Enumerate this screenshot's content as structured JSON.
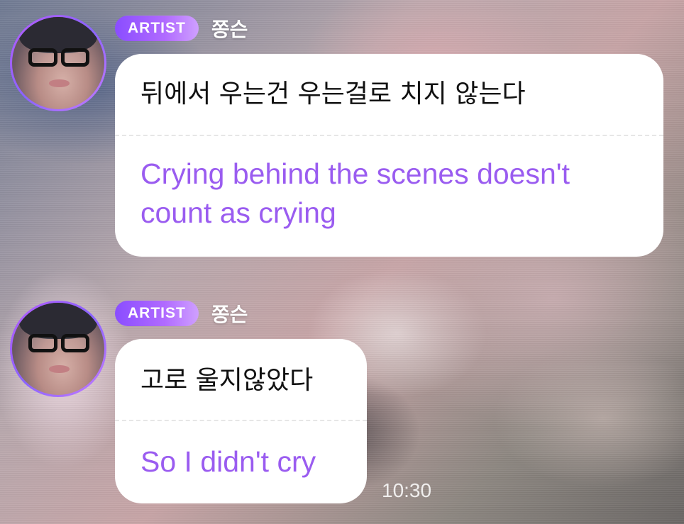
{
  "messages": [
    {
      "badge": "ARTIST",
      "sender": "쫑슨",
      "original": "뒤에서 우는건 우는걸로 치지 않는다",
      "translation": "Crying behind the scenes doesn't count as crying"
    },
    {
      "badge": "ARTIST",
      "sender": "쫑슨",
      "original": "고로 울지않았다",
      "translation": "So I didn't cry"
    }
  ],
  "timestamp": "10:30",
  "colors": {
    "accent": "#9a5cf0",
    "badge_start": "#8a4dff",
    "badge_end": "#cfa0ff",
    "bubble": "#ffffff"
  }
}
